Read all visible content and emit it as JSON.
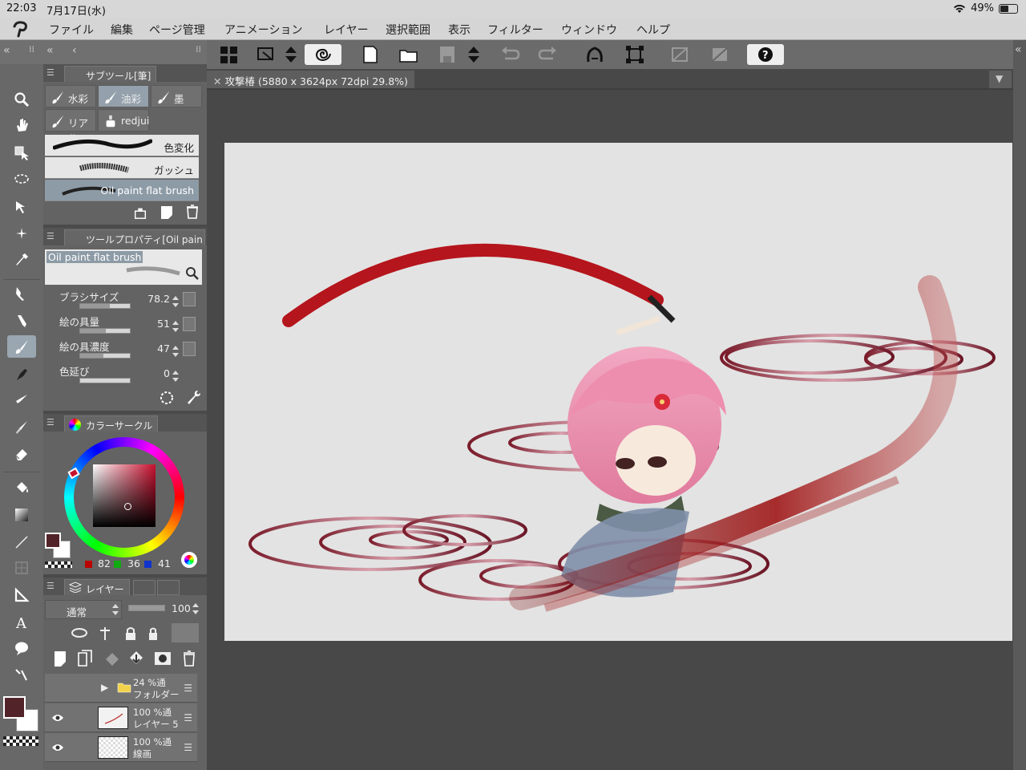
{
  "status": {
    "time": "22:03",
    "date": "7月17日(水)",
    "battery": "49%",
    "battery_level": 0.49
  },
  "menu": [
    "ファイル",
    "編集",
    "ページ管理",
    "アニメーション",
    "レイヤー",
    "選択範囲",
    "表示",
    "フィルター",
    "ウィンドウ",
    "ヘルプ"
  ],
  "document": {
    "tab_label": "攻撃椿 (5880 x 3624px 72dpi 29.8%)"
  },
  "subtool_panel": {
    "title": "サブツール[筆]",
    "tools": [
      "水彩",
      "油彩",
      "墨",
      "リアル",
      "redjui"
    ],
    "selected_tool": "油彩",
    "brushes": [
      "色変化",
      "ガッシュ",
      "Oil paint flat brush"
    ],
    "selected_brush": "Oil paint flat brush"
  },
  "tool_property": {
    "title": "ツールプロパティ[Oil pain",
    "brush_name": "Oil paint flat brush",
    "rows": [
      {
        "label": "ブラシサイズ",
        "value": "78.2"
      },
      {
        "label": "絵の具量",
        "value": "51"
      },
      {
        "label": "絵の具濃度",
        "value": "47"
      },
      {
        "label": "色延び",
        "value": "0"
      }
    ],
    "levels": [
      0.6,
      0.51,
      0.47,
      0.0
    ]
  },
  "color_panel": {
    "title": "カラーサークル",
    "r": "82",
    "g": "36",
    "b": "41",
    "main_color": "#522429",
    "sub_color": "#ffffff"
  },
  "layer_panel": {
    "title": "レイヤー",
    "blend_mode": "通常",
    "opacity": "100",
    "opacity_level": 1.0,
    "layers": [
      {
        "line1": "24 %通",
        "line2": "フォルダー",
        "visible": false,
        "folder": true
      },
      {
        "line1": "100 %通",
        "line2": "レイヤー 5",
        "visible": true,
        "folder": false
      },
      {
        "line1": "100 %通",
        "line2": "線画",
        "visible": true,
        "folder": false
      }
    ]
  },
  "colors": {
    "accent": "#9aa6b0",
    "brush_red": "#c41a1a"
  }
}
